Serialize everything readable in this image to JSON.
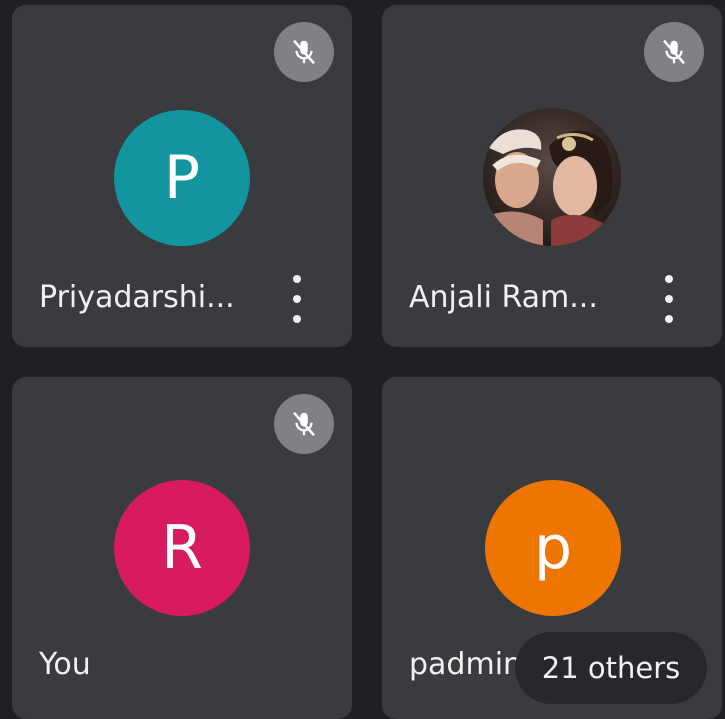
{
  "participants": [
    {
      "name": "Priyadarshi...",
      "initial": "P",
      "avatar_color": "#12959f",
      "muted": true,
      "has_menu": true
    },
    {
      "name": "Anjali Ram...",
      "initial": "",
      "avatar_color": "#2f1a17",
      "muted": true,
      "has_menu": true,
      "avatar_type": "photo"
    },
    {
      "name": "You",
      "initial": "R",
      "avatar_color": "#d81b60",
      "muted": true,
      "has_menu": false
    },
    {
      "name": "padmini",
      "initial": "p",
      "avatar_color": "#ee7502",
      "muted": false,
      "has_menu": false
    }
  ],
  "others_label": "21 others",
  "colors": {
    "background": "#1f2023",
    "tile": "#3a3b3f",
    "mute_badge": "#808185"
  },
  "icons": {
    "mute": "mic-off-icon",
    "menu": "more-vert-icon"
  }
}
